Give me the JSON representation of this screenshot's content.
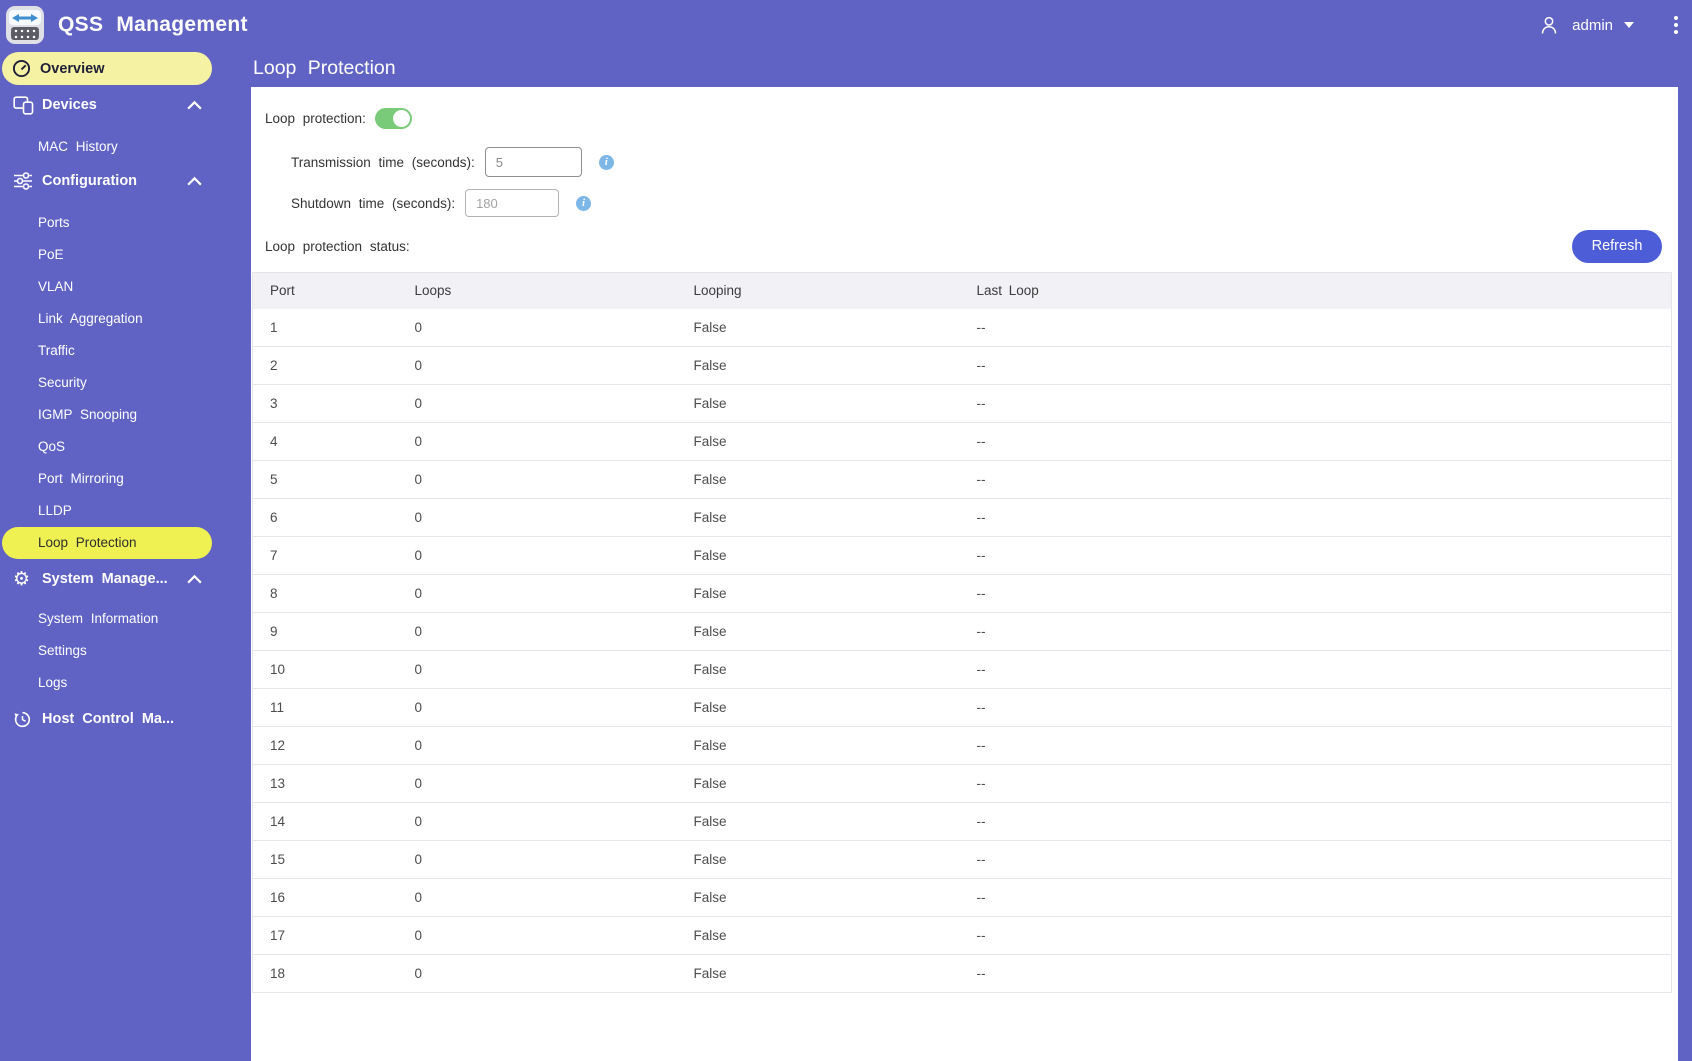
{
  "header": {
    "app_title": "QSS Management",
    "user_name": "admin"
  },
  "page": {
    "title": "Loop Protection"
  },
  "sidebar": {
    "overview_label": "Overview",
    "devices_label": "Devices",
    "devices_children": [
      {
        "label": "MAC History",
        "active": false
      }
    ],
    "configuration_label": "Configuration",
    "configuration_children": [
      {
        "label": "Ports",
        "active": false
      },
      {
        "label": "PoE",
        "active": false
      },
      {
        "label": "VLAN",
        "active": false
      },
      {
        "label": "Link Aggregation",
        "active": false
      },
      {
        "label": "Traffic",
        "active": false
      },
      {
        "label": "Security",
        "active": false
      },
      {
        "label": "IGMP Snooping",
        "active": false
      },
      {
        "label": "QoS",
        "active": false
      },
      {
        "label": "Port Mirroring",
        "active": false
      },
      {
        "label": "LLDP",
        "active": false
      },
      {
        "label": "Loop Protection",
        "active": true
      }
    ],
    "system_label": "System Manage...",
    "system_children": [
      {
        "label": "System Information",
        "active": false
      },
      {
        "label": "Settings",
        "active": false
      },
      {
        "label": "Logs",
        "active": false
      }
    ],
    "host_label": "Host Control Ma..."
  },
  "settings": {
    "loop_protection_label": "Loop protection:",
    "loop_protection_enabled": true,
    "transmission_label": "Transmission time (seconds):",
    "transmission_value": "5",
    "shutdown_label": "Shutdown time (seconds):",
    "shutdown_value": "180",
    "status_label": "Loop protection status:",
    "refresh_label": "Refresh",
    "info_icon_glyph": "i"
  },
  "status_table": {
    "columns": [
      "Port",
      "Loops",
      "Looping",
      "Last Loop"
    ],
    "rows": [
      {
        "port": "1",
        "loops": "0",
        "looping": "False",
        "last_loop": "--"
      },
      {
        "port": "2",
        "loops": "0",
        "looping": "False",
        "last_loop": "--"
      },
      {
        "port": "3",
        "loops": "0",
        "looping": "False",
        "last_loop": "--"
      },
      {
        "port": "4",
        "loops": "0",
        "looping": "False",
        "last_loop": "--"
      },
      {
        "port": "5",
        "loops": "0",
        "looping": "False",
        "last_loop": "--"
      },
      {
        "port": "6",
        "loops": "0",
        "looping": "False",
        "last_loop": "--"
      },
      {
        "port": "7",
        "loops": "0",
        "looping": "False",
        "last_loop": "--"
      },
      {
        "port": "8",
        "loops": "0",
        "looping": "False",
        "last_loop": "--"
      },
      {
        "port": "9",
        "loops": "0",
        "looping": "False",
        "last_loop": "--"
      },
      {
        "port": "10",
        "loops": "0",
        "looping": "False",
        "last_loop": "--"
      },
      {
        "port": "11",
        "loops": "0",
        "looping": "False",
        "last_loop": "--"
      },
      {
        "port": "12",
        "loops": "0",
        "looping": "False",
        "last_loop": "--"
      },
      {
        "port": "13",
        "loops": "0",
        "looping": "False",
        "last_loop": "--"
      },
      {
        "port": "14",
        "loops": "0",
        "looping": "False",
        "last_loop": "--"
      },
      {
        "port": "15",
        "loops": "0",
        "looping": "False",
        "last_loop": "--"
      },
      {
        "port": "16",
        "loops": "0",
        "looping": "False",
        "last_loop": "--"
      },
      {
        "port": "17",
        "loops": "0",
        "looping": "False",
        "last_loop": "--"
      },
      {
        "port": "18",
        "loops": "0",
        "looping": "False",
        "last_loop": "--"
      }
    ]
  },
  "colors": {
    "theme_purple": "#6062c4",
    "overview_pill_yellow": "#f5f3a3",
    "active_pill_yellow": "#eff052",
    "toggle_green": "#79cb79",
    "refresh_blue": "#4d5cd7",
    "info_blue": "#7db7e8",
    "table_header_bg": "#f1f1f6"
  }
}
